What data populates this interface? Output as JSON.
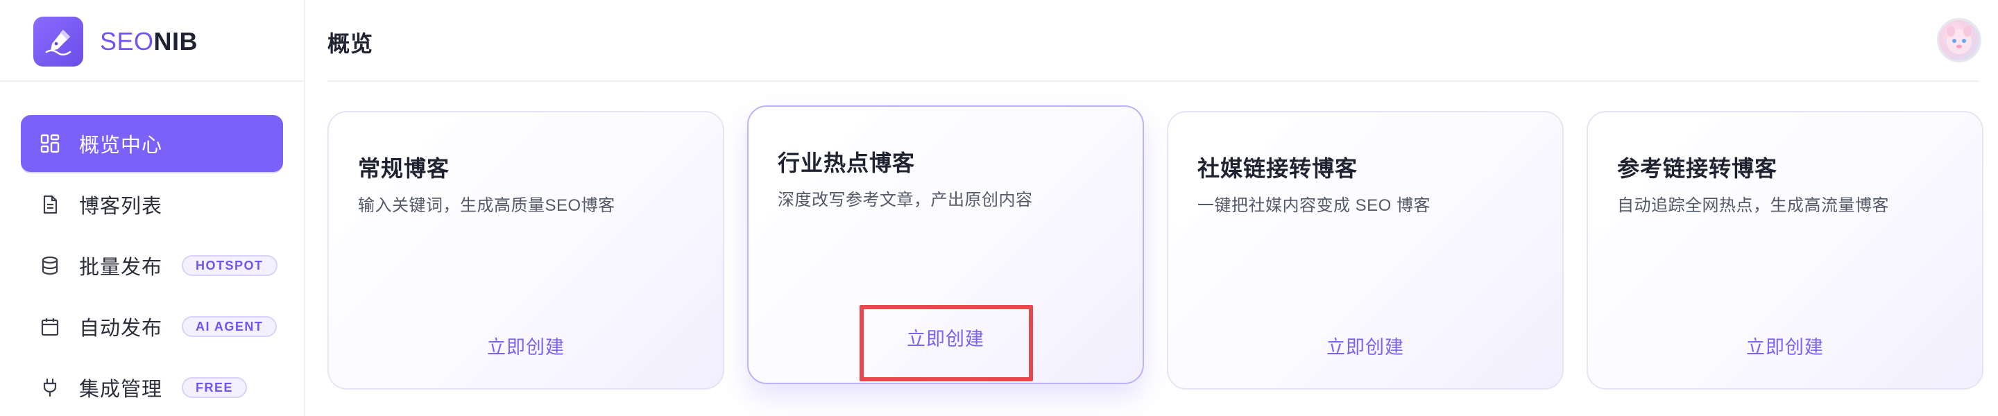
{
  "brand": {
    "name_part1": "SEO",
    "name_part2": "NIB"
  },
  "sidebar": {
    "items": [
      {
        "label": "概览中心",
        "icon": "grid-icon",
        "active": true
      },
      {
        "label": "博客列表",
        "icon": "document-icon"
      },
      {
        "label": "批量发布",
        "icon": "database-icon",
        "badge": "HOTSPOT"
      },
      {
        "label": "自动发布",
        "icon": "calendar-icon",
        "badge": "AI AGENT"
      },
      {
        "label": "集成管理",
        "icon": "plug-icon",
        "badge": "FREE"
      }
    ]
  },
  "header": {
    "title": "概览"
  },
  "cards": [
    {
      "title": "常规博客",
      "description": "输入关键词，生成高质量SEO博客",
      "action": "立即创建"
    },
    {
      "title": "行业热点博客",
      "description": "深度改写参考文章，产出原创内容",
      "action": "立即创建"
    },
    {
      "title": "社媒链接转博客",
      "description": "一键把社媒内容变成 SEO 博客",
      "action": "立即创建"
    },
    {
      "title": "参考链接转博客",
      "description": "自动追踪全网热点，生成高流量博客",
      "action": "立即创建"
    }
  ],
  "colors": {
    "accent": "#7a61f7",
    "highlight_box": "#e5484d"
  }
}
